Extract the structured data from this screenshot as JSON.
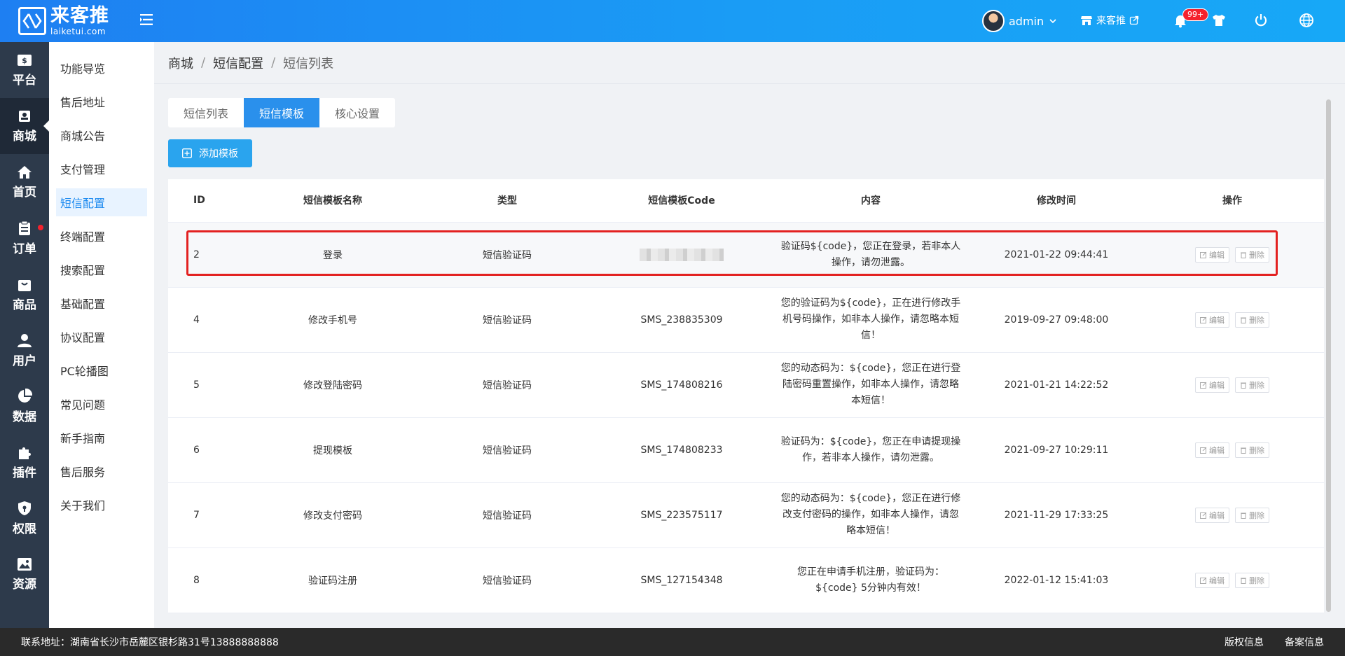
{
  "header": {
    "logo_cn": "来客推",
    "logo_en": "laiketui.com",
    "user_name": "admin",
    "shop_name": "来客推",
    "notification_count": "99+"
  },
  "sidenav": [
    {
      "label": "平台",
      "icon": "dollar-icon"
    },
    {
      "label": "商城",
      "icon": "store-icon",
      "active": true
    },
    {
      "label": "首页",
      "icon": "home-icon"
    },
    {
      "label": "订单",
      "icon": "clipboard-icon",
      "dot": true
    },
    {
      "label": "商品",
      "icon": "bag-icon"
    },
    {
      "label": "用户",
      "icon": "user-icon"
    },
    {
      "label": "数据",
      "icon": "pie-chart-icon"
    },
    {
      "label": "插件",
      "icon": "puzzle-icon"
    },
    {
      "label": "权限",
      "icon": "shield-icon"
    },
    {
      "label": "资源",
      "icon": "image-icon"
    }
  ],
  "submenu": [
    "功能导览",
    "售后地址",
    "商城公告",
    "支付管理",
    "短信配置",
    "终端配置",
    "搜索配置",
    "基础配置",
    "协议配置",
    "PC轮播图",
    "常见问题",
    "新手指南",
    "售后服务",
    "关于我们"
  ],
  "submenu_active": "短信配置",
  "breadcrumb": [
    "商城",
    "短信配置",
    "短信列表"
  ],
  "tabs": [
    "短信列表",
    "短信模板",
    "核心设置"
  ],
  "tab_active": "短信模板",
  "add_button_label": "添加模板",
  "table": {
    "columns": [
      "ID",
      "短信模板名称",
      "类型",
      "短信模板Code",
      "内容",
      "修改时间",
      "操作"
    ],
    "edit_label": "编辑",
    "delete_label": "删除",
    "rows": [
      {
        "id": "2",
        "name": "登录",
        "type": "短信验证码",
        "code": "",
        "content": "验证码${code}，您正在登录，若非本人操作，请勿泄露。",
        "time": "2021-01-22 09:44:41"
      },
      {
        "id": "4",
        "name": "修改手机号",
        "type": "短信验证码",
        "code": "SMS_238835309",
        "content": "您的验证码为${code}，正在进行修改手机号码操作，如非本人操作，请忽略本短信！",
        "time": "2019-09-27 09:48:00"
      },
      {
        "id": "5",
        "name": "修改登陆密码",
        "type": "短信验证码",
        "code": "SMS_174808216",
        "content": "您的动态码为：${code}，您正在进行登陆密码重置操作，如非本人操作，请忽略本短信！",
        "time": "2021-01-21 14:22:52"
      },
      {
        "id": "6",
        "name": "提现模板",
        "type": "短信验证码",
        "code": "SMS_174808233",
        "content": "验证码为：${code}，您正在申请提现操作，若非本人操作，请勿泄露。",
        "time": "2021-09-27 10:29:11"
      },
      {
        "id": "7",
        "name": "修改支付密码",
        "type": "短信验证码",
        "code": "SMS_223575117",
        "content": "您的动态码为：${code}，您正在进行修改支付密码的操作，如非本人操作，请忽略本短信！",
        "time": "2021-11-29 17:33:25"
      },
      {
        "id": "8",
        "name": "验证码注册",
        "type": "短信验证码",
        "code": "SMS_127154348",
        "content": "您正在申请手机注册，验证码为：${code} 5分钟内有效！",
        "time": "2022-01-12 15:41:03"
      }
    ]
  },
  "footer": {
    "address": "联系地址：湖南省长沙市岳麓区银杉路31号13888888888",
    "copyright": "版权信息",
    "record": "备案信息"
  },
  "colors": {
    "header_gradient_start": "#1e7ff2",
    "header_gradient_end": "#17a8f7",
    "sidenav_bg": "#2d3a4b",
    "accent": "#2a90ec",
    "highlight_border": "#e32121",
    "footer_bg": "#2a2a2a"
  }
}
